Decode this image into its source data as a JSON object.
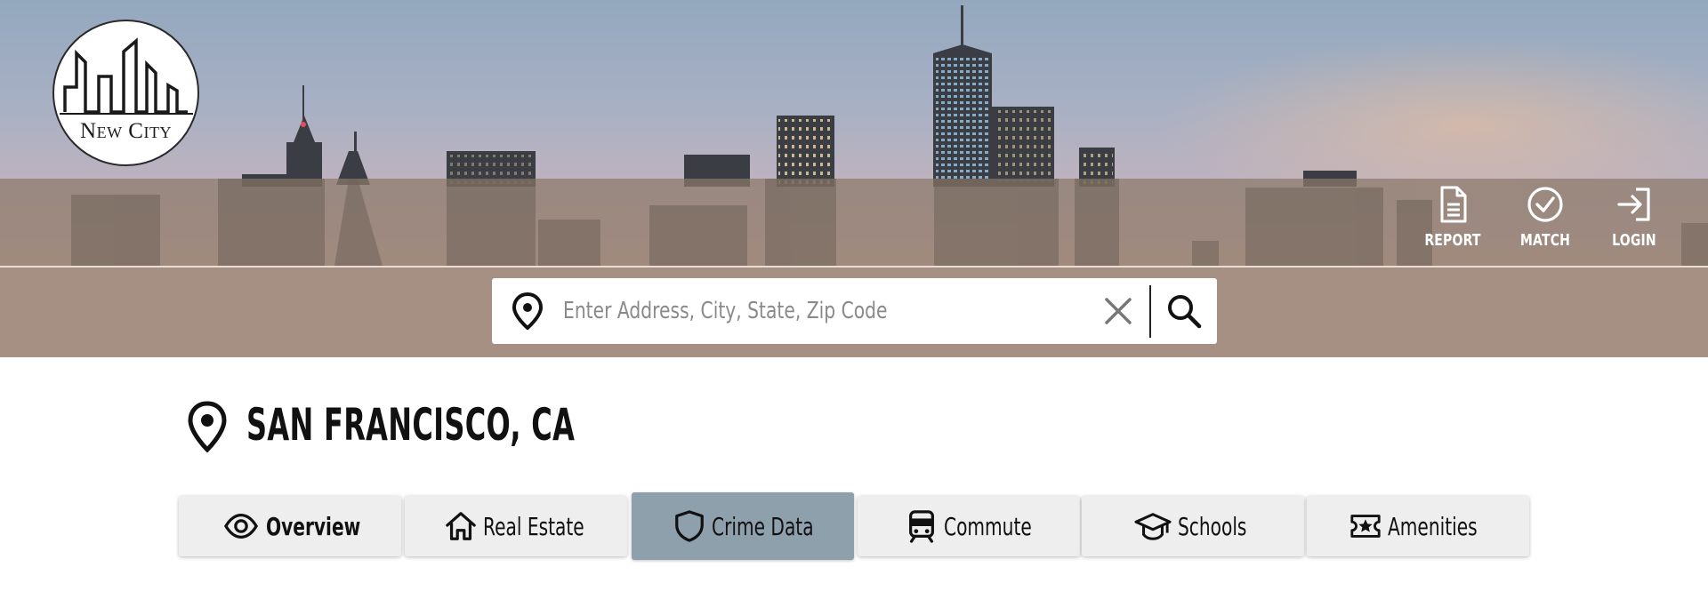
{
  "brand": {
    "logo_text": "New City",
    "logo_name": "new-city-logo"
  },
  "nav": {
    "items": [
      {
        "label": "REPORT",
        "icon": "document-icon"
      },
      {
        "label": "MATCH",
        "icon": "check-circle-icon"
      },
      {
        "label": "LOGIN",
        "icon": "login-icon"
      }
    ]
  },
  "search": {
    "placeholder": "Enter Address, City, State, Zip Code",
    "value": "",
    "pin_icon": "map-pin-icon",
    "clear_icon": "close-icon",
    "submit_icon": "search-icon"
  },
  "location": {
    "title": "SAN FRANCISCO, CA",
    "icon": "map-pin-icon"
  },
  "tabs": [
    {
      "label": "Overview",
      "icon": "eye-icon",
      "selected": false
    },
    {
      "label": "Real Estate",
      "icon": "home-icon",
      "selected": false
    },
    {
      "label": "Crime Data",
      "icon": "shield-icon",
      "selected": true
    },
    {
      "label": "Commute",
      "icon": "train-icon",
      "selected": false
    },
    {
      "label": "Schools",
      "icon": "graduation-cap-icon",
      "selected": false
    },
    {
      "label": "Amenities",
      "icon": "ticket-star-icon",
      "selected": false
    }
  ],
  "colors": {
    "nav_band": "#8b786a",
    "search_band": "#a68f83",
    "active_tab": "#8fa0ad",
    "tab_background": "#eeeeee",
    "text_dark": "#111111"
  }
}
